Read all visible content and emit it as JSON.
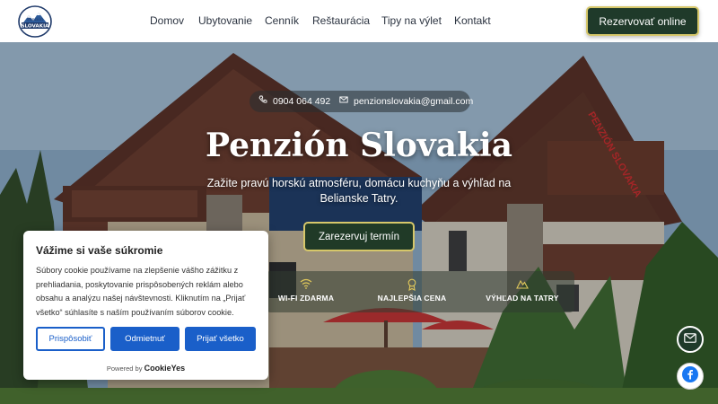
{
  "header": {
    "logo_text_top": "Penzión",
    "logo_text_main": "SLOVAKIA",
    "nav": [
      {
        "label": "Domov"
      },
      {
        "label": "Ubytovanie"
      },
      {
        "label": "Cenník"
      },
      {
        "label": "Reštaurácia"
      },
      {
        "label": "Tipy na výlet"
      },
      {
        "label": "Kontakt"
      }
    ],
    "reserve_label": "Rezervovať online"
  },
  "hero": {
    "phone": "0904 064 492",
    "email": "penzionslovakia@gmail.com",
    "title": "Penzión Slovakia",
    "subtitle": "Zažite pravú horskú atmosféru, domácu kuchyňu a výhľad na Belianske Tatry.",
    "cta_label": "Zarezervuj termín",
    "features": [
      {
        "label": "WI-FI ZDARMA",
        "icon": "wifi-icon"
      },
      {
        "label": "NAJLEPŠIA CENA",
        "icon": "award-icon"
      },
      {
        "label": "VÝHĽAD NA TATRY",
        "icon": "mountain-icon"
      }
    ],
    "sign_text": "PENZIÓN SLOVAKIA"
  },
  "cookie": {
    "title": "Vážime si vaše súkromie",
    "text": "Súbory cookie používame na zlepšenie vášho zážitku z prehliadania, poskytovanie prispôsobených reklám alebo obsahu a analýzu našej návštevnosti. Kliknutím na „Prijať všetko“ súhlasíte s naším používaním súborov cookie.",
    "customize_label": "Prispôsobiť",
    "reject_label": "Odmietnuť",
    "accept_label": "Prijať všetko",
    "powered_prefix": "Powered by",
    "powered_brand": "CookieYes"
  },
  "colors": {
    "accent_green": "#1f3a2a",
    "accent_gold": "#d6c76a",
    "cookie_blue": "#1a5fc9",
    "facebook_blue": "#1877f2"
  }
}
